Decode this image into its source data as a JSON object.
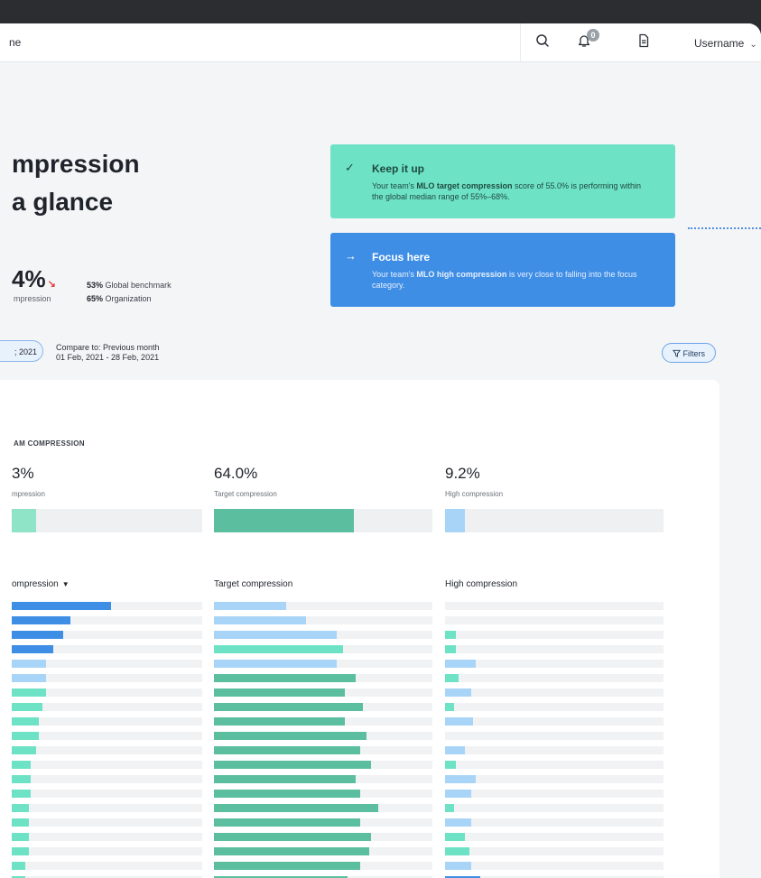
{
  "topbar": {
    "breadcrumb": "ne",
    "notifications_count": "0",
    "username": "Username",
    "chevron": "⌄"
  },
  "title_lines": [
    "mpression",
    "a glance"
  ],
  "kpi": {
    "value": "4%",
    "arrow": "↘",
    "label": "mpression",
    "benchmarks": [
      {
        "value": "53%",
        "label": "Global benchmark"
      },
      {
        "value": "65%",
        "label": "Organization"
      }
    ]
  },
  "cards": [
    {
      "icon": "check-icon",
      "glyph": "✓",
      "title": "Keep it up",
      "body_pre": "Your team's ",
      "body_bold": "MLO target compression",
      "body_post": " score of 55.0% is performing within the global median range of 55%–68%."
    },
    {
      "icon": "arrow-right-icon",
      "glyph": "→",
      "title": "Focus here",
      "body_pre": "Your team's ",
      "body_bold": "MLO high compression",
      "body_post": " is very close to falling into the focus category."
    }
  ],
  "date_range": {
    "pill_text": "; 2021",
    "compare_label": "Compare to: Previous month",
    "compare_range": "01 Feb, 2021 - 28 Feb, 2021"
  },
  "filters_label": "Filters",
  "team_section": {
    "label": "AM COMPRESSION",
    "metrics": [
      {
        "value": "3%",
        "label": "mpression",
        "fill": 0.13,
        "color": "#8fe3c7"
      },
      {
        "value": "64.0%",
        "label": "Target compression",
        "fill": 0.64,
        "color": "#5bbf9f"
      },
      {
        "value": "9.2%",
        "label": "High compression",
        "fill": 0.092,
        "color": "#a8d4f7"
      }
    ]
  },
  "columns": [
    {
      "header": "ompression",
      "sort": "▼"
    },
    {
      "header": "Target compression"
    },
    {
      "header": "High compression"
    }
  ],
  "rows": {
    "col1": [
      {
        "v": 0.52,
        "c": "#3f8ee6"
      },
      {
        "v": 0.31,
        "c": "#3f8ee6"
      },
      {
        "v": 0.27,
        "c": "#3f8ee6"
      },
      {
        "v": 0.22,
        "c": "#3f8ee6"
      },
      {
        "v": 0.18,
        "c": "#a8d4f7"
      },
      {
        "v": 0.18,
        "c": "#a8d4f7"
      },
      {
        "v": 0.18,
        "c": "#6ee2c5"
      },
      {
        "v": 0.16,
        "c": "#6ee2c5"
      },
      {
        "v": 0.14,
        "c": "#6ee2c5"
      },
      {
        "v": 0.14,
        "c": "#6ee2c5"
      },
      {
        "v": 0.13,
        "c": "#6ee2c5"
      },
      {
        "v": 0.1,
        "c": "#6ee2c5"
      },
      {
        "v": 0.1,
        "c": "#6ee2c5"
      },
      {
        "v": 0.1,
        "c": "#6ee2c5"
      },
      {
        "v": 0.09,
        "c": "#6ee2c5"
      },
      {
        "v": 0.09,
        "c": "#6ee2c5"
      },
      {
        "v": 0.09,
        "c": "#6ee2c5"
      },
      {
        "v": 0.09,
        "c": "#6ee2c5"
      },
      {
        "v": 0.07,
        "c": "#6ee2c5"
      },
      {
        "v": 0.07,
        "c": "#6ee2c5"
      },
      {
        "v": 0.06,
        "c": "#6ee2c5"
      }
    ],
    "col2": [
      {
        "v": 0.33,
        "c": "#a8d4f7"
      },
      {
        "v": 0.42,
        "c": "#a8d4f7"
      },
      {
        "v": 0.56,
        "c": "#a8d4f7"
      },
      {
        "v": 0.59,
        "c": "#6ee2c5"
      },
      {
        "v": 0.56,
        "c": "#a8d4f7"
      },
      {
        "v": 0.65,
        "c": "#5bbf9f"
      },
      {
        "v": 0.6,
        "c": "#5bbf9f"
      },
      {
        "v": 0.68,
        "c": "#5bbf9f"
      },
      {
        "v": 0.6,
        "c": "#5bbf9f"
      },
      {
        "v": 0.7,
        "c": "#5bbf9f"
      },
      {
        "v": 0.67,
        "c": "#5bbf9f"
      },
      {
        "v": 0.72,
        "c": "#5bbf9f"
      },
      {
        "v": 0.65,
        "c": "#5bbf9f"
      },
      {
        "v": 0.67,
        "c": "#5bbf9f"
      },
      {
        "v": 0.75,
        "c": "#5bbf9f"
      },
      {
        "v": 0.67,
        "c": "#5bbf9f"
      },
      {
        "v": 0.72,
        "c": "#5bbf9f"
      },
      {
        "v": 0.71,
        "c": "#5bbf9f"
      },
      {
        "v": 0.67,
        "c": "#5bbf9f"
      },
      {
        "v": 0.61,
        "c": "#5bbf9f"
      },
      {
        "v": 0.6,
        "c": "#5bbf9f"
      }
    ],
    "col3": [
      {
        "v": 0,
        "c": "#a8d4f7"
      },
      {
        "v": 0,
        "c": "#a8d4f7"
      },
      {
        "v": 0.05,
        "c": "#6ee2c5"
      },
      {
        "v": 0.05,
        "c": "#6ee2c5"
      },
      {
        "v": 0.14,
        "c": "#a8d4f7"
      },
      {
        "v": 0.06,
        "c": "#6ee2c5"
      },
      {
        "v": 0.12,
        "c": "#a8d4f7"
      },
      {
        "v": 0.04,
        "c": "#6ee2c5"
      },
      {
        "v": 0.13,
        "c": "#a8d4f7"
      },
      {
        "v": 0,
        "c": "#a8d4f7"
      },
      {
        "v": 0.09,
        "c": "#a8d4f7"
      },
      {
        "v": 0.05,
        "c": "#6ee2c5"
      },
      {
        "v": 0.14,
        "c": "#a8d4f7"
      },
      {
        "v": 0.12,
        "c": "#a8d4f7"
      },
      {
        "v": 0.04,
        "c": "#6ee2c5"
      },
      {
        "v": 0.12,
        "c": "#a8d4f7"
      },
      {
        "v": 0.09,
        "c": "#6ee2c5"
      },
      {
        "v": 0.11,
        "c": "#6ee2c5"
      },
      {
        "v": 0.12,
        "c": "#a8d4f7"
      },
      {
        "v": 0.16,
        "c": "#3f8ee6"
      },
      {
        "v": 0.1,
        "c": "#a8d4f7"
      }
    ]
  },
  "colors": {
    "green_card": "#6ee2c5",
    "blue_card": "#3f8ee6",
    "page_bg": "#f4f5f7"
  }
}
